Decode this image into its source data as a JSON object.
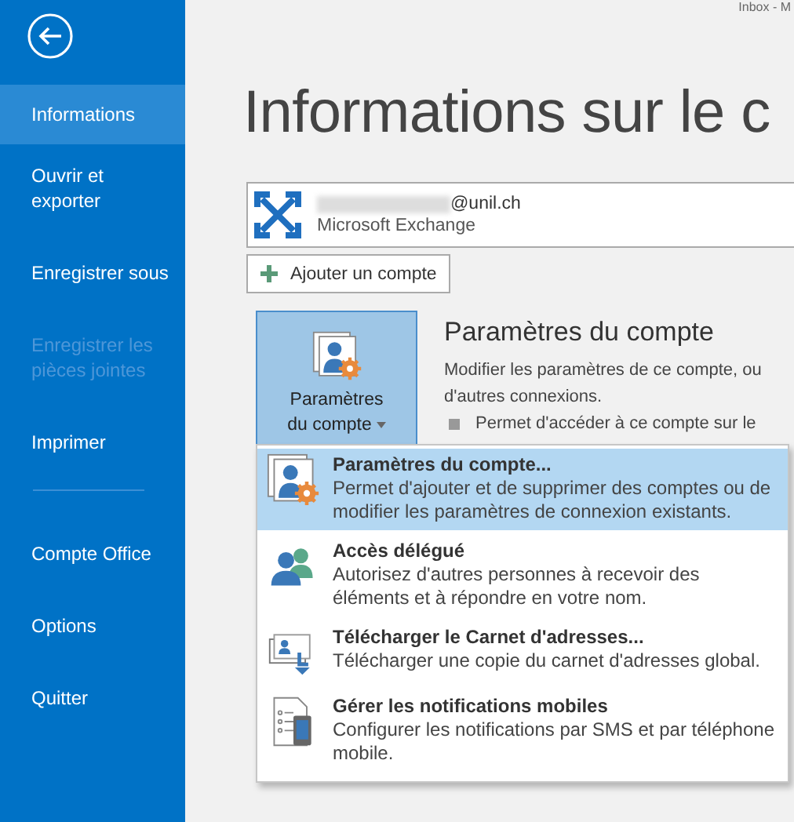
{
  "sidebar": {
    "items": [
      {
        "label": "Informations",
        "selected": true,
        "disabled": false
      },
      {
        "label": "Ouvrir et exporter",
        "selected": false,
        "disabled": false
      },
      {
        "label": "Enregistrer sous",
        "selected": false,
        "disabled": false
      },
      {
        "label": "Enregistrer les pièces jointes",
        "selected": false,
        "disabled": true
      },
      {
        "label": "Imprimer",
        "selected": false,
        "disabled": false
      },
      {
        "label": "Compte Office",
        "selected": false,
        "disabled": false
      },
      {
        "label": "Options",
        "selected": false,
        "disabled": false
      },
      {
        "label": "Quitter",
        "selected": false,
        "disabled": false
      }
    ]
  },
  "top_bar": {
    "text": "Inbox - M"
  },
  "title": "Informations sur le c",
  "account": {
    "email": "@unil.ch",
    "type": "Microsoft Exchange"
  },
  "add_account": "Ajouter un compte",
  "account_settings": {
    "button_label": "Paramètres du compte",
    "heading": "Paramètres du compte",
    "description": "Modifier les paramètres de ce compte, ou",
    "description_2": "d'autres connexions.",
    "bullet": "Permet d'accéder à ce compte sur le"
  },
  "menu": {
    "items": [
      {
        "kind": "settings",
        "title": "Paramètres du compte...",
        "description": "Permet d'ajouter et de supprimer des comptes ou de modifier les paramètres de connexion existants.",
        "selected": true
      },
      {
        "kind": "delegate",
        "title": "Accès délégué",
        "description": "Autorisez d'autres personnes à recevoir des éléments et à répondre en votre nom.",
        "selected": false
      },
      {
        "kind": "addressbook",
        "title": "Télécharger le Carnet d'adresses...",
        "description": "Télécharger une copie du carnet d'adresses global.",
        "selected": false
      },
      {
        "kind": "mobile",
        "title": "Gérer les notifications mobiles",
        "description": "Configurer les notifications par SMS et par téléphone mobile.",
        "selected": false
      }
    ]
  }
}
